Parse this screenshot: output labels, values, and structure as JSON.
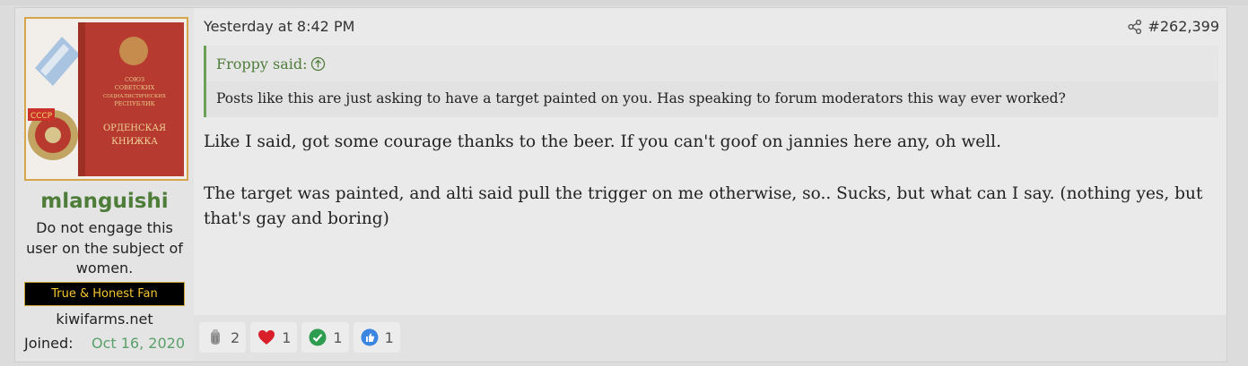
{
  "post": {
    "date": "Yesterday at 8:42 PM",
    "number": "#262,399",
    "user": {
      "name": "mlanguishi",
      "title": "Do not engage this user on the subject of women.",
      "banner": "True & Honest Fan",
      "site": "kiwifarms.net",
      "joined_label": "Joined:",
      "joined_date": "Oct 16, 2020",
      "avatar_lines": [
        "СОЮЗ",
        "СОВЕТСКИХ",
        "СОЦИАЛИСТИЧЕСКИХ",
        "РЕСПУБЛИК",
        "ОРДЕНСКАЯ",
        "КНИЖКА",
        "СССР"
      ]
    },
    "quote": {
      "author": "Froppy said:",
      "text": "Posts like this are just asking to have a target painted on you. Has speaking to forum moderators this way ever worked?"
    },
    "body": [
      "Like I said, got some courage thanks to the beer. If you can't goof on jannies here any, oh well.",
      "The target was painted, and alti said pull the trigger on me otherwise, so.. Sucks, but what can I say. (nothing yes, but that's gay and boring)"
    ],
    "reactions": [
      {
        "icon": "dumb-icon",
        "count": "2"
      },
      {
        "icon": "heart-icon",
        "count": "1"
      },
      {
        "icon": "checkmark-icon",
        "count": "1"
      },
      {
        "icon": "thumbs-up-icon",
        "count": "1"
      }
    ]
  },
  "colors": {
    "username": "#4e7d3a",
    "quote_border": "#6aa358",
    "banner_bg": "#000000",
    "banner_text": "#f5c630",
    "joined_date": "#5aa06a"
  }
}
